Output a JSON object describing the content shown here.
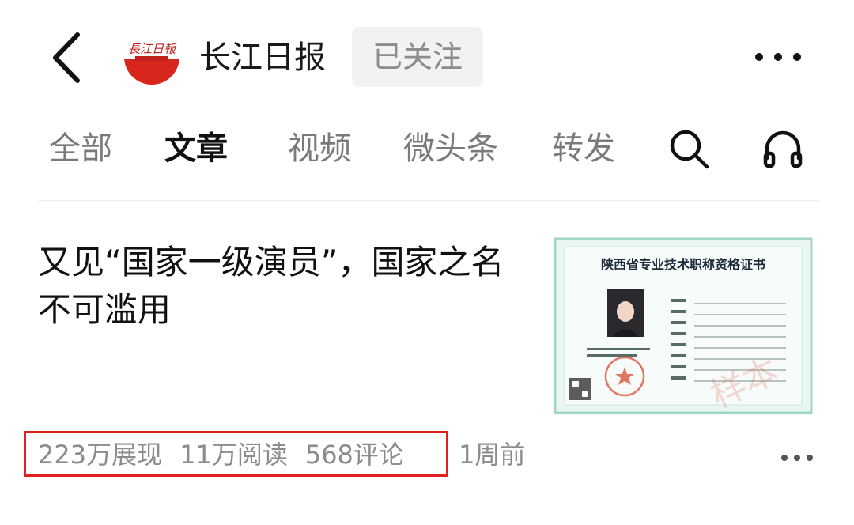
{
  "header": {
    "outlet_name": "长江日报",
    "logo_text": "長江日報",
    "follow_label": "已关注"
  },
  "tabs": [
    {
      "label": "全部",
      "active": false
    },
    {
      "label": "文章",
      "active": true
    },
    {
      "label": "视频",
      "active": false
    },
    {
      "label": "微头条",
      "active": false
    },
    {
      "label": "转发",
      "active": false
    }
  ],
  "icons": {
    "back": "chevron-left-icon",
    "more": "more-horizontal-icon",
    "search": "search-icon",
    "listen": "headphones-icon"
  },
  "article": {
    "headline": "又见“国家一级演员”，国家之名不可滥用",
    "thumbnail": {
      "title": "陕西省专业技术职称资格证书",
      "watermark": "样本"
    },
    "stats": {
      "impressions": "223万展现",
      "reads": "11万阅读",
      "comments": "568评论"
    },
    "time": "1周前"
  },
  "colors": {
    "accent_red": "#d9261c",
    "highlight_border": "#e02020",
    "muted_text": "#8c8c8c"
  }
}
